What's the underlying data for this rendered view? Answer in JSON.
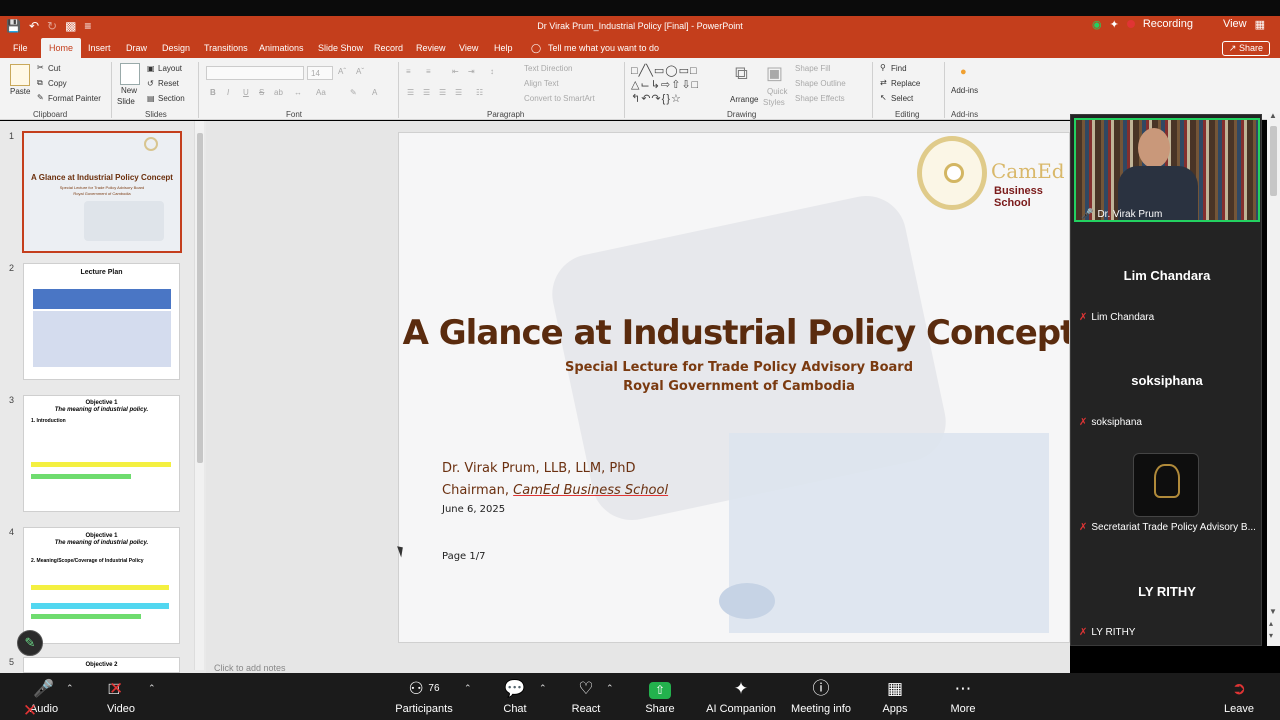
{
  "window": {
    "title": "Dr Virak Prum_Industrial Policy [Final]  -  PowerPoint"
  },
  "zoom_status": {
    "recording_label": "Recording",
    "view_label": "View"
  },
  "ribbon_tabs": {
    "file": "File",
    "home": "Home",
    "insert": "Insert",
    "draw": "Draw",
    "design": "Design",
    "transitions": "Transitions",
    "animations": "Animations",
    "slide_show": "Slide Show",
    "record": "Record",
    "review": "Review",
    "view": "View",
    "help": "Help",
    "tell_me": "Tell me what you want to do",
    "share": "Share"
  },
  "ribbon": {
    "clipboard": {
      "paste": "Paste",
      "cut": "Cut",
      "copy": "Copy",
      "format_painter": "Format Painter",
      "label": "Clipboard"
    },
    "slides": {
      "new_slide_line1": "New",
      "new_slide_line2": "Slide",
      "layout": "Layout",
      "reset": "Reset",
      "section": "Section",
      "label": "Slides"
    },
    "font": {
      "size": "14",
      "label": "Font",
      "bold": "B",
      "italic": "I",
      "underline": "U",
      "strike": "S",
      "shadow": "ab"
    },
    "paragraph": {
      "text_direction": "Text Direction",
      "align_text": "Align Text",
      "smartart": "Convert to SmartArt",
      "label": "Paragraph"
    },
    "drawing": {
      "arrange": "Arrange",
      "quick_styles_line1": "Quick",
      "quick_styles_line2": "Styles",
      "shape_fill": "Shape Fill",
      "shape_outline": "Shape Outline",
      "shape_effects": "Shape Effects",
      "label": "Drawing"
    },
    "editing": {
      "find": "Find",
      "replace": "Replace",
      "select": "Select",
      "label": "Editing"
    },
    "addins": {
      "addins": "Add-ins",
      "label": "Add-ins"
    }
  },
  "thumbnails": {
    "numbers": [
      "1",
      "2",
      "3",
      "4",
      "5"
    ],
    "t1": {
      "title": "A Glance at Industrial Policy Concept",
      "sub1": "Special Lecture for Trade Policy Advisory Board",
      "sub2": "Royal Government of Cambodia"
    },
    "t2": {
      "title": "Lecture Plan"
    },
    "t3": {
      "title": "Objective 1",
      "subtitle": "The meaning of industrial policy.",
      "heading": "1. Introduction"
    },
    "t4": {
      "title": "Objective 1",
      "subtitle": "The meaning of industrial policy.",
      "heading": "2. Meaning/Scope/Coverage of Industrial Policy"
    },
    "t5": {
      "title": "Objective 2"
    }
  },
  "slide": {
    "logo_text": "CamEd",
    "logo_sub": "Business School",
    "title": "A Glance at Industrial Policy Concept",
    "subtitle_1": "Special Lecture for Trade Policy Advisory Board",
    "subtitle_2": "Royal Government of Cambodia",
    "author": "Dr. Virak Prum, LLB, LLM, PhD",
    "role_prefix": "Chairman, ",
    "role_org": "CamEd Business School",
    "date": "June 6, 2025",
    "page": "Page 1/7"
  },
  "notes_placeholder": "Click to add notes",
  "participants_panel": {
    "speaker": "Dr. Virak Prum",
    "p1_big": "Lim Chandara",
    "p1": "Lim Chandara",
    "p2_big": "soksiphana",
    "p2": "soksiphana",
    "p3": "Secretariat Trade Policy Advisory B...",
    "p4_big": "LY RITHY",
    "p4": "LY RITHY"
  },
  "toolbar": {
    "audio": "Audio",
    "video": "Video",
    "participants": "Participants",
    "participants_count": "76",
    "chat": "Chat",
    "react": "React",
    "share": "Share",
    "ai_companion": "AI Companion",
    "meeting_info": "Meeting info",
    "apps": "Apps",
    "more": "More",
    "leave": "Leave"
  },
  "colors": {
    "powerpoint_orange": "#c43e1c",
    "zoom_green": "#23d160",
    "title_brown": "#5a2b0e"
  }
}
